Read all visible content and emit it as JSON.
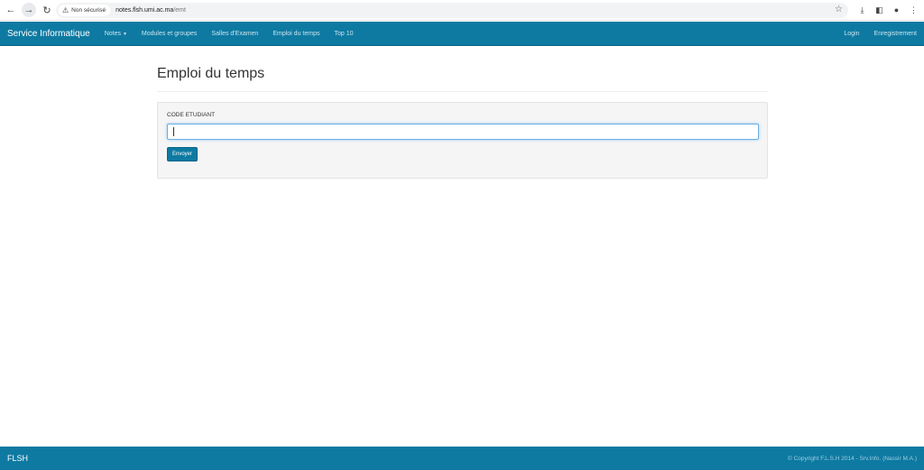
{
  "browser": {
    "security_label": "Non sécurisé",
    "url_host": "notes.flsh.umi.ac.ma",
    "url_path": "/emt"
  },
  "navbar": {
    "brand": "Service Informatique",
    "items": [
      {
        "label": "Notes"
      },
      {
        "label": "Modules et groupes"
      },
      {
        "label": "Salles d'Examen"
      },
      {
        "label": "Emploi du temps"
      },
      {
        "label": "Top 10"
      }
    ],
    "right": [
      {
        "label": "Login"
      },
      {
        "label": "Enregistrement"
      }
    ]
  },
  "main": {
    "title": "Emploi du temps",
    "form": {
      "label": "CODE ETUDIANT",
      "input_value": "",
      "submit_label": "Envoyer"
    }
  },
  "footer": {
    "brand": "FLSH",
    "copyright": "© Copyright F.L.S.H 2014 - Srv.Info. (Nassir M.A.)"
  },
  "colors": {
    "primary": "#0e7aa2"
  }
}
